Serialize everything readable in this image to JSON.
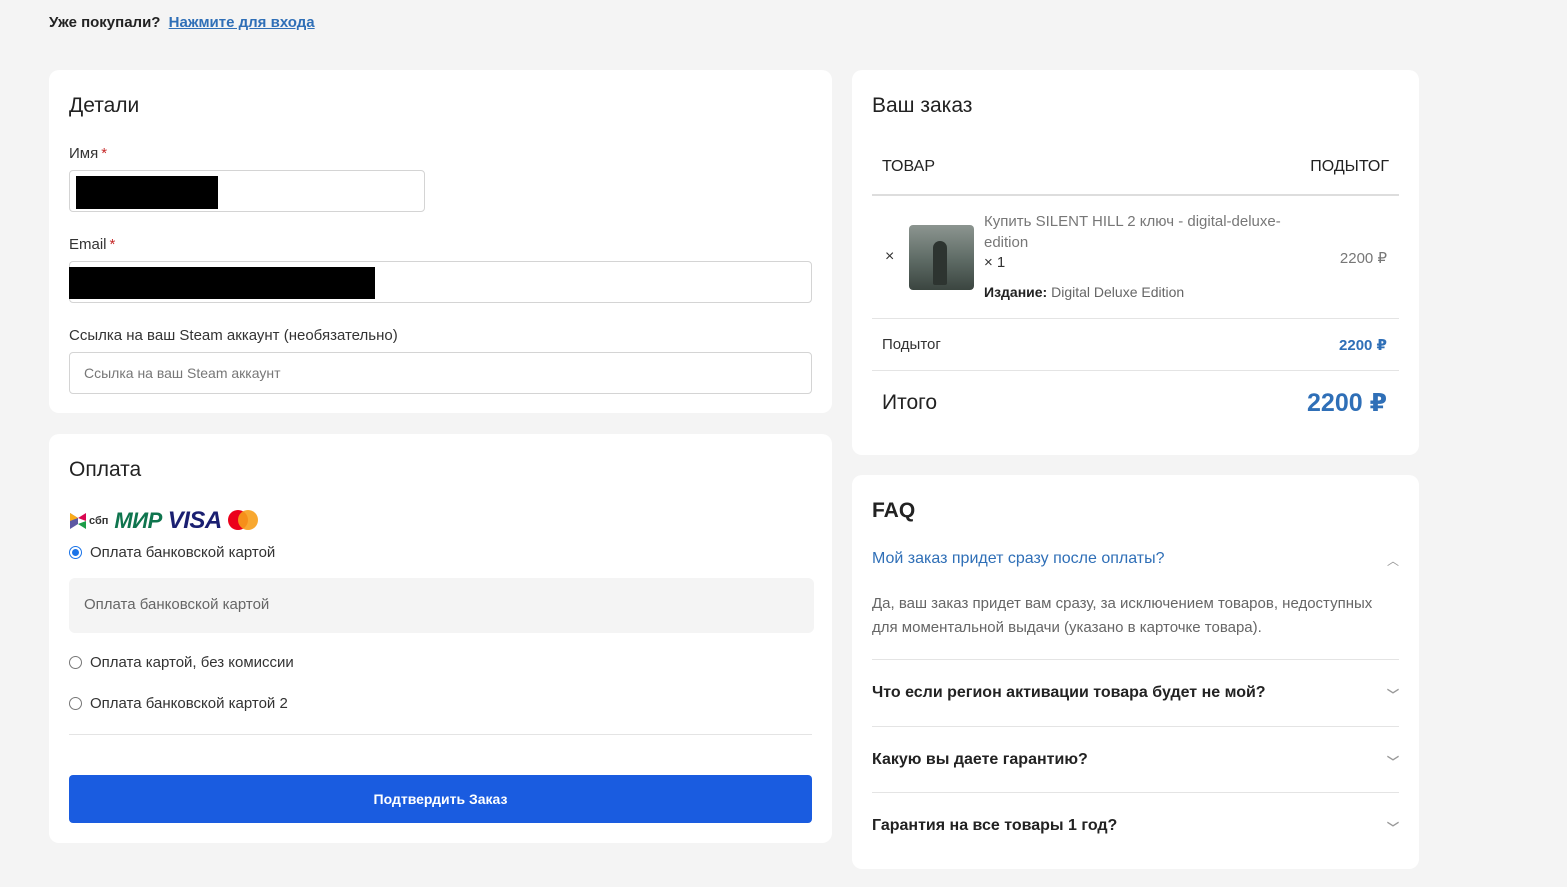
{
  "header": {
    "returning_text": "Уже покупали?",
    "login_link": "Нажмите для входа"
  },
  "details": {
    "title": "Детали",
    "name_label": "Имя",
    "email_label": "Email",
    "required_mark": "*",
    "steam_label": "Ссылка на ваш Steam аккаунт (необязательно)",
    "steam_placeholder": "Ссылка на ваш Steam аккаунт"
  },
  "payment": {
    "title": "Оплата",
    "logos": [
      "sbp-logo",
      "mir-logo",
      "visa-logo",
      "mastercard-logo"
    ],
    "logo_text": {
      "sbp": "сбп",
      "mir": "МИР",
      "visa": "VISA"
    },
    "options": [
      {
        "label": "Оплата банковской картой",
        "checked": true
      },
      {
        "label": "Оплата картой, без комиссии",
        "checked": false
      },
      {
        "label": "Оплата банковской картой 2",
        "checked": false
      }
    ],
    "selected_description": "Оплата банковской картой",
    "submit_label": "Подтвердить Заказ",
    "accent_color": "#1a5ce0"
  },
  "order": {
    "title": "Ваш заказ",
    "col_product": "ТОВАР",
    "col_subtotal": "ПОДЫТОГ",
    "remove_icon": "×",
    "item": {
      "name": "Купить SILENT HILL 2 ключ - digital-deluxe-edition",
      "qty": "× 1",
      "meta_label": "Издание:",
      "meta_value": "Digital Deluxe Edition",
      "price": "2200 ₽"
    },
    "subtotal_label": "Подытог",
    "subtotal_value": "2200 ₽",
    "total_label": "Итого",
    "total_value": "2200 ₽",
    "price_color": "#2f6fb7"
  },
  "faq": {
    "title": "FAQ",
    "items": [
      {
        "q": "Мой заказ придет сразу после оплаты?",
        "open": true,
        "a": "Да, ваш заказ придет вам сразу, за исключением товаров, недоступных для моментальной выдачи (указано в карточке товара)."
      },
      {
        "q": "Что если регион активации товара будет не мой?",
        "open": false
      },
      {
        "q": "Какую вы даете гарантию?",
        "open": false
      },
      {
        "q": "Гарантия на все товары 1 год?",
        "open": false
      }
    ]
  }
}
